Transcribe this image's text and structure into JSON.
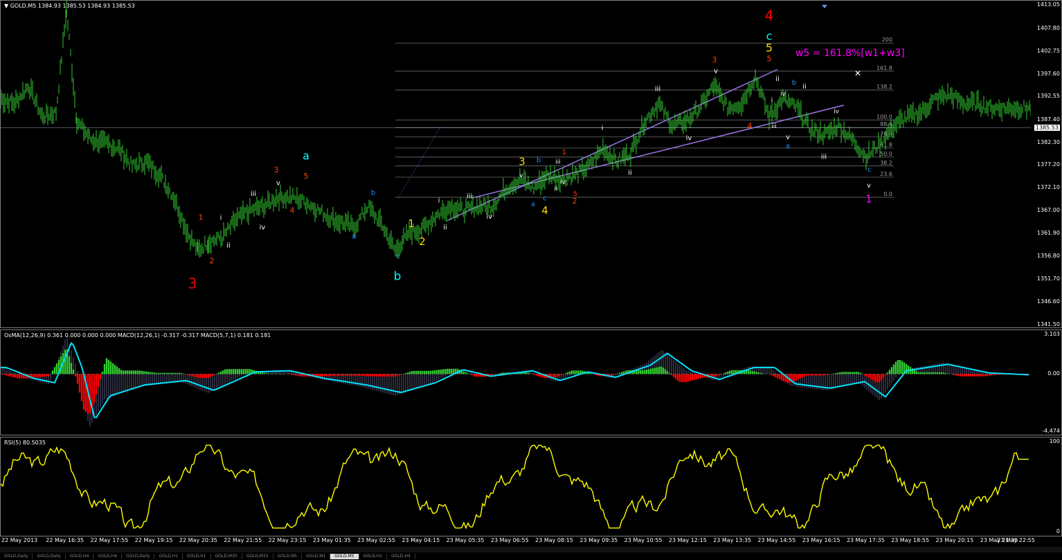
{
  "chart_data": [
    {
      "type": "line",
      "title": "GOLD,M5",
      "header_values": "1384.93 1385.53 1384.93 1385.53",
      "ylim": [
        1341.5,
        1413.05
      ],
      "ticks": [
        "1413.05",
        "1407.80",
        "1402.75",
        "1397.60",
        "1392.55",
        "1387.40",
        "1382.30",
        "1377.20",
        "1372.10",
        "1367.00",
        "1361.90",
        "1356.80",
        "1351.70",
        "1346.60",
        "1341.50"
      ],
      "current_price": "1385.53",
      "price_path_x": [
        0,
        20,
        40,
        60,
        80,
        95,
        110,
        130,
        150,
        170,
        190,
        210,
        230,
        250,
        270,
        285,
        300,
        320,
        340,
        360,
        380,
        400,
        420,
        440,
        460,
        480,
        500,
        510,
        530,
        550,
        570,
        590,
        610,
        630,
        650,
        670,
        690,
        710,
        730,
        750,
        770,
        790,
        810,
        830,
        850,
        870,
        890,
        910,
        930,
        950,
        970,
        990,
        1010,
        1030,
        1050,
        1070,
        1090,
        1110,
        1130,
        1150,
        1170,
        1190,
        1210,
        1230,
        1250,
        1270,
        1290,
        1310,
        1330,
        1350,
        1370,
        1390,
        1410,
        1430,
        1450,
        1470,
        1490
      ],
      "price_path_y": [
        1392,
        1391,
        1395,
        1388,
        1389,
        1412,
        1387,
        1383,
        1382,
        1381,
        1377,
        1378,
        1375,
        1370,
        1362,
        1358,
        1360,
        1361,
        1365,
        1367,
        1368,
        1370,
        1370,
        1369,
        1367,
        1365,
        1364,
        1363,
        1368,
        1364,
        1358,
        1362,
        1363,
        1366,
        1368,
        1367,
        1368,
        1368,
        1372,
        1374,
        1372,
        1375,
        1374,
        1375,
        1377,
        1381,
        1378,
        1380,
        1387,
        1391,
        1386,
        1387,
        1390,
        1395,
        1390,
        1391,
        1397,
        1388,
        1392,
        1390,
        1385,
        1384,
        1386,
        1383,
        1379,
        1382,
        1386,
        1388,
        1389,
        1392,
        1393,
        1391,
        1391,
        1390,
        1390,
        1390,
        1390
      ],
      "fib_levels": [
        {
          "label": "200",
          "price": 1404.5
        },
        {
          "label": "161.8",
          "price": 1398.2
        },
        {
          "label": "138.2",
          "price": 1394.0
        },
        {
          "label": "100.0",
          "price": 1387.3
        },
        {
          "label": "88.6",
          "price": 1385.6
        },
        {
          "label": "76.4",
          "price": 1383.5
        },
        {
          "label": "61.8",
          "price": 1381.0
        },
        {
          "label": "50.0",
          "price": 1379.0
        },
        {
          "label": "38.2",
          "price": 1377.0
        },
        {
          "label": "23.6",
          "price": 1374.5
        },
        {
          "label": "0.0",
          "price": 1370.0
        }
      ],
      "annotation_formula": "w5 = 161.8%[w1+w3]",
      "wave_labels": [
        {
          "text": "3",
          "color": "#ff0000",
          "x": 277,
          "p": 1349.6,
          "size": 20
        },
        {
          "text": "1",
          "color": "#ff4500",
          "x": 289,
          "p": 1365,
          "size": 11
        },
        {
          "text": "2",
          "color": "#ff4500",
          "x": 305,
          "p": 1355.2,
          "size": 11
        },
        {
          "text": "i",
          "color": "#ffffff",
          "x": 318,
          "p": 1365,
          "size": 10
        },
        {
          "text": "ii",
          "color": "#ffffff",
          "x": 329,
          "p": 1358.8,
          "size": 10
        },
        {
          "text": "iii",
          "color": "#ffffff",
          "x": 365,
          "p": 1370.3,
          "size": 10
        },
        {
          "text": "iv",
          "color": "#ffffff",
          "x": 378,
          "p": 1362.8,
          "size": 10
        },
        {
          "text": "3",
          "color": "#ff4500",
          "x": 398,
          "p": 1375.6,
          "size": 11
        },
        {
          "text": "v",
          "color": "#ffffff",
          "x": 401,
          "p": 1372.7,
          "size": 10
        },
        {
          "text": "4",
          "color": "#ff4500",
          "x": 421,
          "p": 1366.5,
          "size": 11
        },
        {
          "text": "5",
          "color": "#ff4500",
          "x": 441,
          "p": 1374.2,
          "size": 11
        },
        {
          "text": "a",
          "color": "#00ffff",
          "x": 441,
          "p": 1378.4,
          "size": 16
        },
        {
          "text": "b",
          "color": "#1e90ff",
          "x": 538,
          "p": 1370.5,
          "size": 10
        },
        {
          "text": "a",
          "color": "#1e90ff",
          "x": 510,
          "p": 1360.8,
          "size": 10
        },
        {
          "text": "c",
          "color": "#1e90ff",
          "x": 574,
          "p": 1356.3,
          "size": 10
        },
        {
          "text": "b",
          "color": "#00ffff",
          "x": 573,
          "p": 1351.5,
          "size": 17
        },
        {
          "text": "1",
          "color": "#ffd700",
          "x": 593,
          "p": 1363.3,
          "size": 15
        },
        {
          "text": "2",
          "color": "#ffd700",
          "x": 609,
          "p": 1359.3,
          "size": 15
        },
        {
          "text": "i",
          "color": "#ffffff",
          "x": 633,
          "p": 1368.8,
          "size": 10
        },
        {
          "text": "ii",
          "color": "#ffffff",
          "x": 642,
          "p": 1362.8,
          "size": 10
        },
        {
          "text": "iii",
          "color": "#ffffff",
          "x": 677,
          "p": 1369.8,
          "size": 10
        },
        {
          "text": "iv",
          "color": "#ffffff",
          "x": 706,
          "p": 1365.2,
          "size": 10
        },
        {
          "text": "3",
          "color": "#ffd700",
          "x": 753,
          "p": 1377.2,
          "size": 15
        },
        {
          "text": "v",
          "color": "#ffffff",
          "x": 752,
          "p": 1374.5,
          "size": 9
        },
        {
          "text": "b",
          "color": "#1e90ff",
          "x": 777,
          "p": 1377.8,
          "size": 10
        },
        {
          "text": "a",
          "color": "#1e90ff",
          "x": 769,
          "p": 1368.0,
          "size": 10
        },
        {
          "text": "c",
          "color": "#1e90ff",
          "x": 786,
          "p": 1369.3,
          "size": 10
        },
        {
          "text": "4",
          "color": "#ffd700",
          "x": 786,
          "p": 1366.3,
          "size": 15
        },
        {
          "text": "1",
          "color": "#ff4500",
          "x": 814,
          "p": 1379.6,
          "size": 10
        },
        {
          "text": "iii",
          "color": "#ffffff",
          "x": 805,
          "p": 1377.5,
          "size": 9
        },
        {
          "text": "iv",
          "color": "#ffffff",
          "x": 812,
          "p": 1373.0,
          "size": 9
        },
        {
          "text": "ii",
          "color": "#ffffff",
          "x": 802,
          "p": 1371.5,
          "size": 9
        },
        {
          "text": "5",
          "color": "#ff4500",
          "x": 830,
          "p": 1370.3,
          "size": 9
        },
        {
          "text": "2",
          "color": "#ff4500",
          "x": 829,
          "p": 1368.6,
          "size": 11
        },
        {
          "text": "i",
          "color": "#ffffff",
          "x": 869,
          "p": 1385.0,
          "size": 10
        },
        {
          "text": "ii",
          "color": "#ffffff",
          "x": 909,
          "p": 1375.0,
          "size": 10
        },
        {
          "text": "iii",
          "color": "#ffffff",
          "x": 949,
          "p": 1393.8,
          "size": 10
        },
        {
          "text": "iv",
          "color": "#ffffff",
          "x": 994,
          "p": 1382.8,
          "size": 10
        },
        {
          "text": "3",
          "color": "#ff4500",
          "x": 1031,
          "p": 1400.2,
          "size": 11
        },
        {
          "text": "v",
          "color": "#ffffff",
          "x": 1033,
          "p": 1397.8,
          "size": 10
        },
        {
          "text": "4",
          "color": "#ff4500",
          "x": 1082,
          "p": 1385.4,
          "size": 11
        },
        {
          "text": "5",
          "color": "#ff4500",
          "x": 1110,
          "p": 1400.4,
          "size": 11
        },
        {
          "text": "4",
          "color": "#ff0000",
          "x": 1110,
          "p": 1409.6,
          "size": 20
        },
        {
          "text": "c",
          "color": "#00ffff",
          "x": 1110,
          "p": 1405.2,
          "size": 16
        },
        {
          "text": "5",
          "color": "#ffd700",
          "x": 1110,
          "p": 1402.6,
          "size": 16
        },
        {
          "text": "ii",
          "color": "#ffffff",
          "x": 1122,
          "p": 1396.0,
          "size": 10
        },
        {
          "text": "i",
          "color": "#ffffff",
          "x": 1114,
          "p": 1391.2,
          "size": 10
        },
        {
          "text": "iv",
          "color": "#ffffff",
          "x": 1130,
          "p": 1392.8,
          "size": 9
        },
        {
          "text": "iii",
          "color": "#ffffff",
          "x": 1117,
          "p": 1385.5,
          "size": 9
        },
        {
          "text": "b",
          "color": "#1e90ff",
          "x": 1146,
          "p": 1395.2,
          "size": 10
        },
        {
          "text": "ii",
          "color": "#ffffff",
          "x": 1161,
          "p": 1394.3,
          "size": 10
        },
        {
          "text": "iv",
          "color": "#ffffff",
          "x": 1207,
          "p": 1388.8,
          "size": 9
        },
        {
          "text": "v",
          "color": "#ffffff",
          "x": 1137,
          "p": 1383.0,
          "size": 10
        },
        {
          "text": "a",
          "color": "#1e90ff",
          "x": 1137,
          "p": 1381.0,
          "size": 10
        },
        {
          "text": "iii",
          "color": "#ffffff",
          "x": 1189,
          "p": 1378.6,
          "size": 10
        },
        {
          "text": "c",
          "color": "#1e90ff",
          "x": 1255,
          "p": 1375.7,
          "size": 10
        },
        {
          "text": "v",
          "color": "#ffffff",
          "x": 1254,
          "p": 1372.2,
          "size": 10
        },
        {
          "text": "1",
          "color": "#ff00ff",
          "x": 1254,
          "p": 1368.8,
          "size": 15
        }
      ]
    },
    {
      "type": "area",
      "title": "OsMA(12,26,9) 0.361 0.000 0.000 0.000  MACD(12,26,1) -0.317 -0.317  MACD(5,7,1) 0.181 0.181",
      "ylim": [
        -4.474,
        3.103
      ],
      "ticks": [
        "3.103",
        "0.00",
        "-4.474"
      ]
    },
    {
      "type": "line",
      "title": "RSI(5) 80.5035",
      "ylim": [
        0,
        100
      ],
      "ticks": [
        "100",
        "0"
      ]
    }
  ],
  "time_axis": [
    "22 May 2013",
    "22 May 16:35",
    "22 May 17:55",
    "22 May 19:15",
    "22 May 20:35",
    "22 May 21:55",
    "22 May 23:15",
    "23 May 01:35",
    "23 May 02:55",
    "23 May 04:15",
    "23 May 05:35",
    "23 May 06:55",
    "23 May 08:15",
    "23 May 09:35",
    "23 May 10:55",
    "23 May 12:15",
    "23 May 13:35",
    "23 May 14:55",
    "23 May 16:15",
    "23 May 17:35",
    "23 May 18:55",
    "23 May 20:15",
    "23 May 21:35",
    "23 May 22:55"
  ],
  "tabs": [
    "GOLD,Daily",
    "GOLD,Daily",
    "GOLD,H4",
    "GOLD,H4",
    "GOLD,Daily",
    "GOLD,H1",
    "GOLD,H1",
    "GOLD,M30",
    "GOLD,M15",
    "GOLD,M5",
    "GOLD,M1",
    "GOLD,M5",
    "GOLD,H1",
    "GOLD,H4"
  ],
  "active_tab_index": 11,
  "colors": {
    "price": "#32cd32",
    "trend": "#9370db",
    "rsi": "#ffff00",
    "macd_signal": "#00e5ff",
    "osma_pos": "#32cd32",
    "osma_neg": "#ff0000",
    "fib": "#808080",
    "formula": "#ff00ff"
  }
}
